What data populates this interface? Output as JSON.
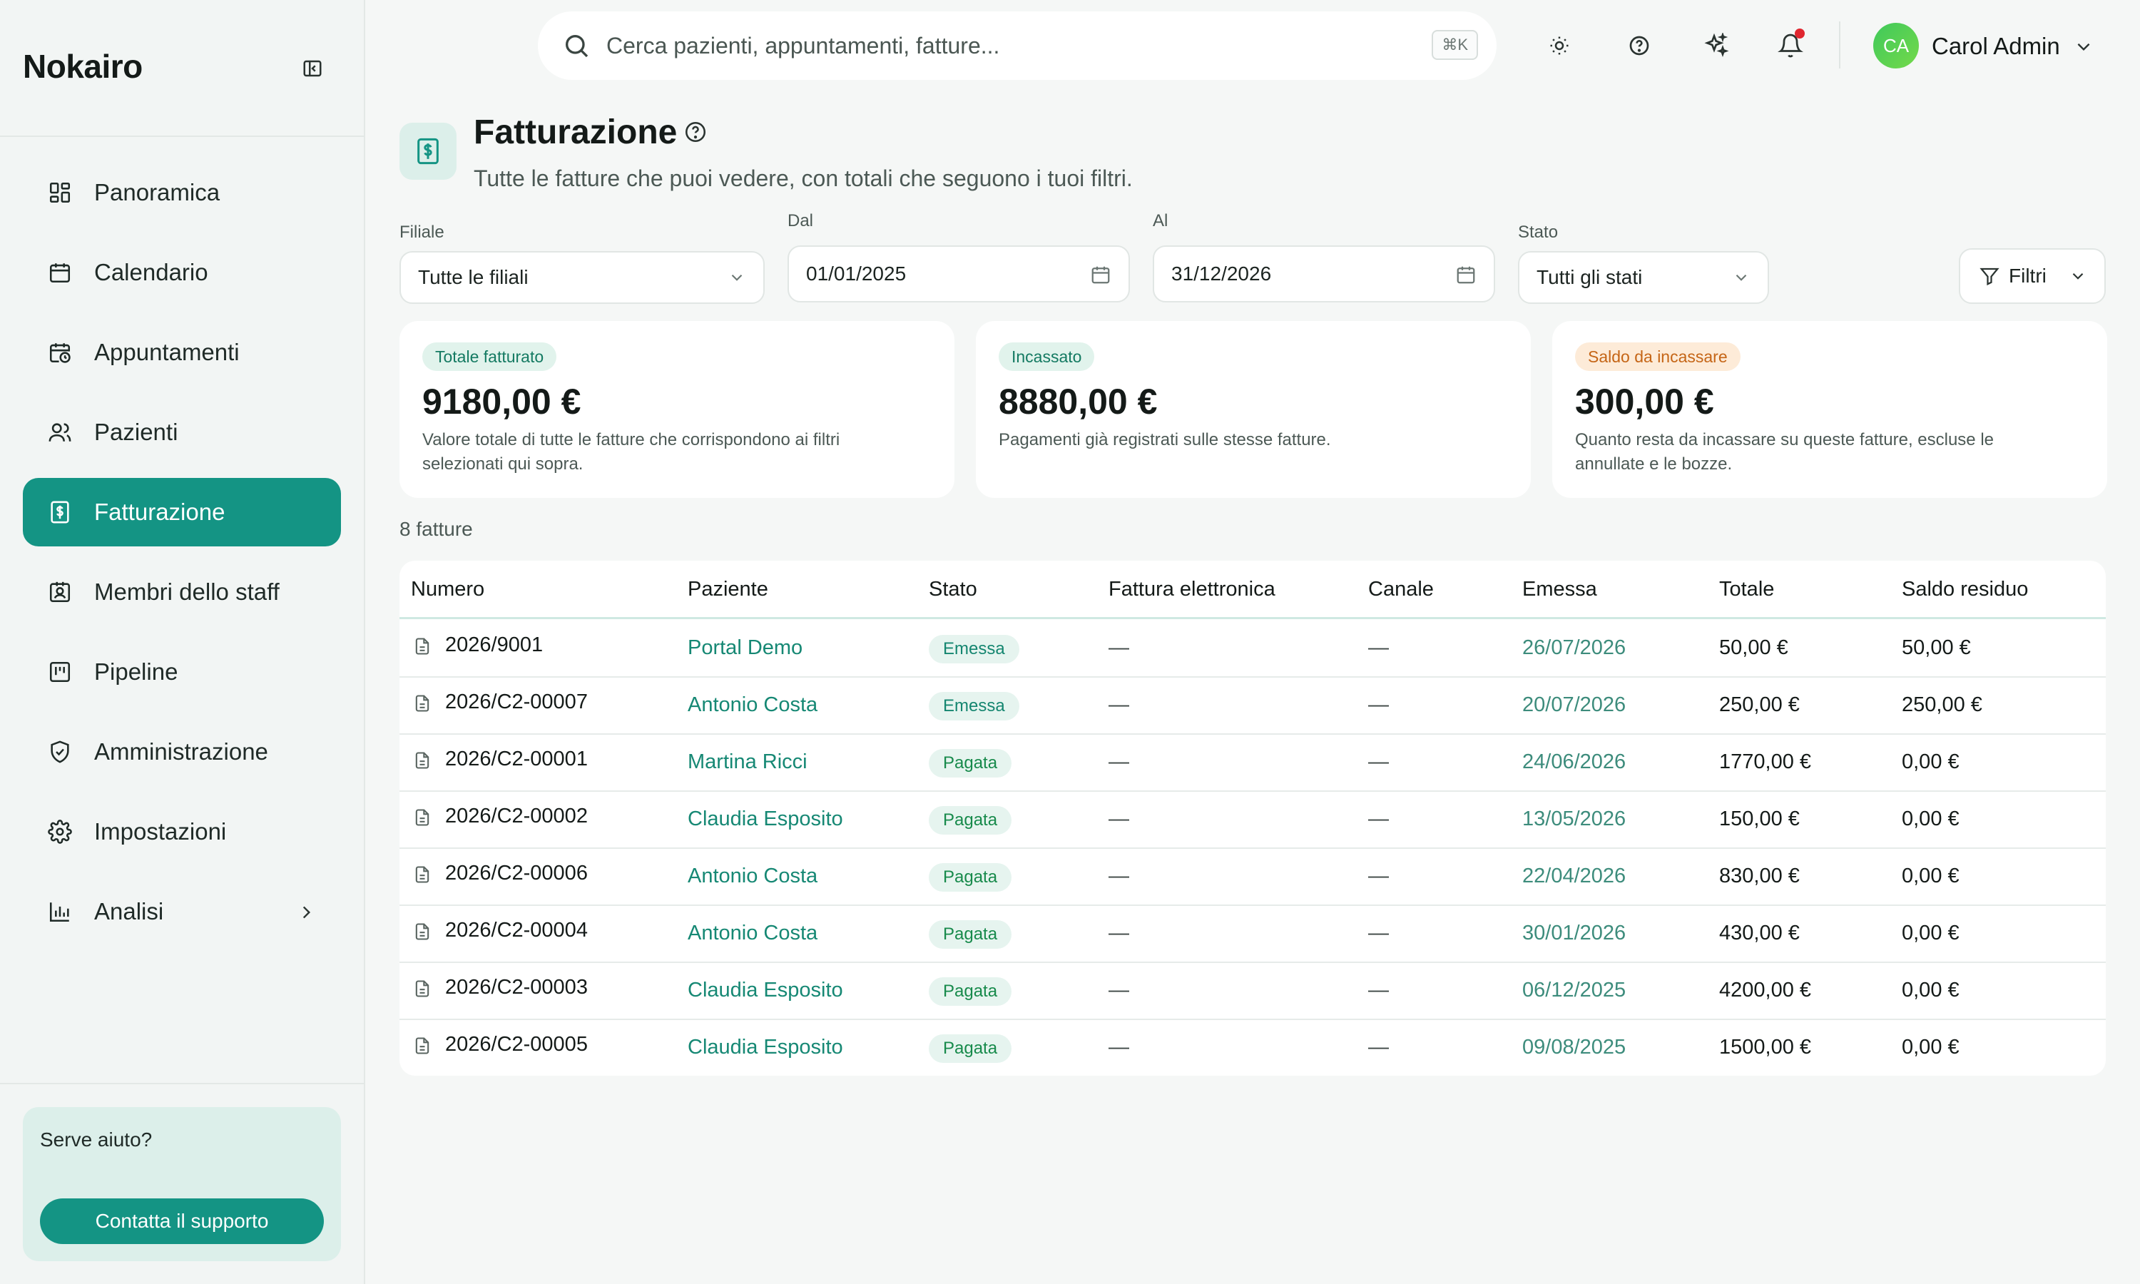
{
  "app": {
    "brand": "Nokairo"
  },
  "sidebar": {
    "items": [
      {
        "label": "Panoramica",
        "icon": "dashboard-icon"
      },
      {
        "label": "Calendario",
        "icon": "calendar-icon"
      },
      {
        "label": "Appuntamenti",
        "icon": "calendar-clock-icon"
      },
      {
        "label": "Pazienti",
        "icon": "users-icon"
      },
      {
        "label": "Fatturazione",
        "icon": "invoice-icon",
        "active": true
      },
      {
        "label": "Membri dello staff",
        "icon": "badge-icon"
      },
      {
        "label": "Pipeline",
        "icon": "kanban-icon"
      },
      {
        "label": "Amministrazione",
        "icon": "shield-icon"
      },
      {
        "label": "Impostazioni",
        "icon": "gear-icon"
      },
      {
        "label": "Analisi",
        "icon": "bar-chart-icon",
        "has_submenu": true
      }
    ],
    "help": {
      "title": "Serve aiuto?",
      "button": "Contatta il supporto"
    }
  },
  "topbar": {
    "search_placeholder": "Cerca pazienti, appuntamenti, fatture...",
    "shortcut": "⌘K",
    "user": {
      "initials": "CA",
      "name": "Carol Admin"
    }
  },
  "page": {
    "title": "Fatturazione",
    "subtitle": "Tutte le fatture che puoi vedere, con totali che seguono i tuoi filtri."
  },
  "filters": {
    "branch": {
      "label": "Filiale",
      "value": "Tutte le filiali"
    },
    "from": {
      "label": "Dal",
      "value": "01/01/2025"
    },
    "to": {
      "label": "Al",
      "value": "31/12/2026"
    },
    "status": {
      "label": "Stato",
      "value": "Tutti gli stati"
    },
    "more_button": "Filtri"
  },
  "kpis": [
    {
      "badge": "Totale fatturato",
      "value": "9180,00 €",
      "description": "Valore totale di tutte le fatture che corrispondono ai filtri selezionati qui sopra."
    },
    {
      "badge": "Incassato",
      "value": "8880,00 €",
      "description": "Pagamenti già registrati sulle stesse fatture."
    },
    {
      "badge": "Saldo da incassare",
      "value": "300,00 €",
      "description": "Quanto resta da incassare su queste fatture, escluse le annullate e le bozze."
    }
  ],
  "invoices": {
    "count_label": "8 fatture",
    "columns": [
      "Numero",
      "Paziente",
      "Stato",
      "Fattura elettronica",
      "Canale",
      "Emessa",
      "Totale",
      "Saldo residuo"
    ],
    "rows": [
      {
        "number": "2026/9001",
        "patient": "Portal Demo",
        "status": "Emessa",
        "einvoice": "—",
        "channel": "—",
        "issued": "26/07/2026",
        "total": "50,00 €",
        "balance": "50,00 €"
      },
      {
        "number": "2026/C2-00007",
        "patient": "Antonio Costa",
        "status": "Emessa",
        "einvoice": "—",
        "channel": "—",
        "issued": "20/07/2026",
        "total": "250,00 €",
        "balance": "250,00 €"
      },
      {
        "number": "2026/C2-00001",
        "patient": "Martina Ricci",
        "status": "Pagata",
        "einvoice": "—",
        "channel": "—",
        "issued": "24/06/2026",
        "total": "1770,00 €",
        "balance": "0,00 €"
      },
      {
        "number": "2026/C2-00002",
        "patient": "Claudia Esposito",
        "status": "Pagata",
        "einvoice": "—",
        "channel": "—",
        "issued": "13/05/2026",
        "total": "150,00 €",
        "balance": "0,00 €"
      },
      {
        "number": "2026/C2-00006",
        "patient": "Antonio Costa",
        "status": "Pagata",
        "einvoice": "—",
        "channel": "—",
        "issued": "22/04/2026",
        "total": "830,00 €",
        "balance": "0,00 €"
      },
      {
        "number": "2026/C2-00004",
        "patient": "Antonio Costa",
        "status": "Pagata",
        "einvoice": "—",
        "channel": "—",
        "issued": "30/01/2026",
        "total": "430,00 €",
        "balance": "0,00 €"
      },
      {
        "number": "2026/C2-00003",
        "patient": "Claudia Esposito",
        "status": "Pagata",
        "einvoice": "—",
        "channel": "—",
        "issued": "06/12/2025",
        "total": "4200,00 €",
        "balance": "0,00 €"
      },
      {
        "number": "2026/C2-00005",
        "patient": "Claudia Esposito",
        "status": "Pagata",
        "einvoice": "—",
        "channel": "—",
        "issued": "09/08/2025",
        "total": "1500,00 €",
        "balance": "0,00 €"
      }
    ]
  },
  "colors": {
    "accent": "#149484",
    "accent_soft": "#dcefea",
    "warning": "#c56516",
    "notification": "#e0262f"
  }
}
